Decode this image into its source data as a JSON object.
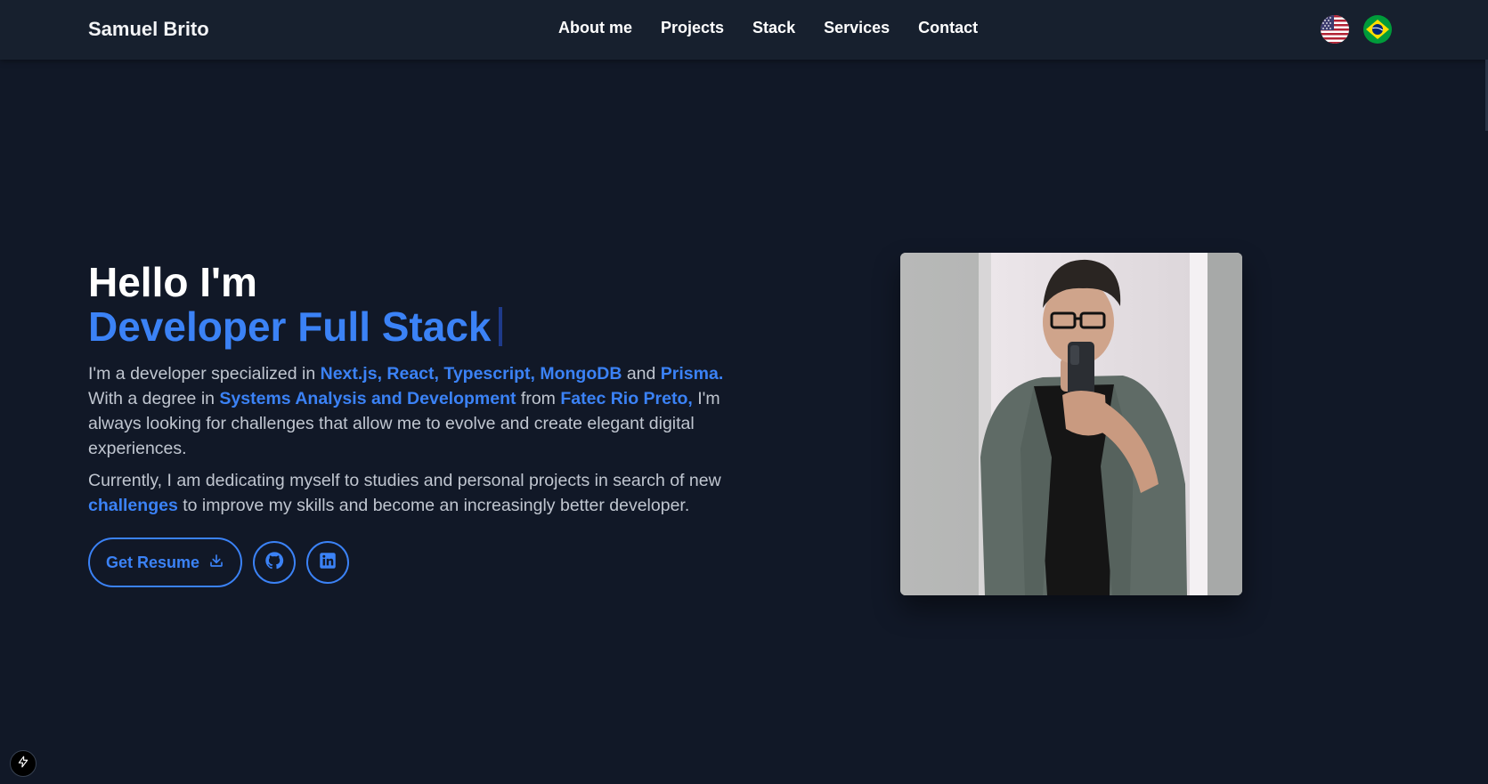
{
  "header": {
    "brand": "Samuel Brito",
    "nav": [
      "About me",
      "Projects",
      "Stack",
      "Services",
      "Contact"
    ],
    "languages": [
      {
        "code": "en",
        "icon": "us-flag-icon"
      },
      {
        "code": "pt",
        "icon": "brazil-flag-icon"
      }
    ]
  },
  "hero": {
    "greeting": "Hello I'm",
    "role": "Developer Full Stack",
    "paragraph1": {
      "t1": "I'm a developer specialized in ",
      "h1": "Next.js, React, Typescript, MongoDB",
      "t2": " and ",
      "h2": "Prisma.",
      "t3": " With a degree in ",
      "h3": "Systems Analysis and Development",
      "t4": " from ",
      "h4": "Fatec Rio Preto,",
      "t5": " I'm always looking for challenges that allow me to evolve and create elegant digital experiences."
    },
    "paragraph2": {
      "t1": "Currently, I am dedicating myself to studies and personal projects in search of new ",
      "h1": "challenges",
      "t2": " to improve my skills and become an increasingly better developer."
    },
    "resume_button": "Get Resume",
    "resume_icon": "download-icon",
    "social": [
      {
        "name": "github",
        "icon": "github-icon"
      },
      {
        "name": "linkedin",
        "icon": "linkedin-icon"
      }
    ]
  },
  "colors": {
    "background": "#111827",
    "navbar": "#17202e",
    "accent": "#3b82f6",
    "text": "#ffffff",
    "muted": "#c0c6d0"
  }
}
